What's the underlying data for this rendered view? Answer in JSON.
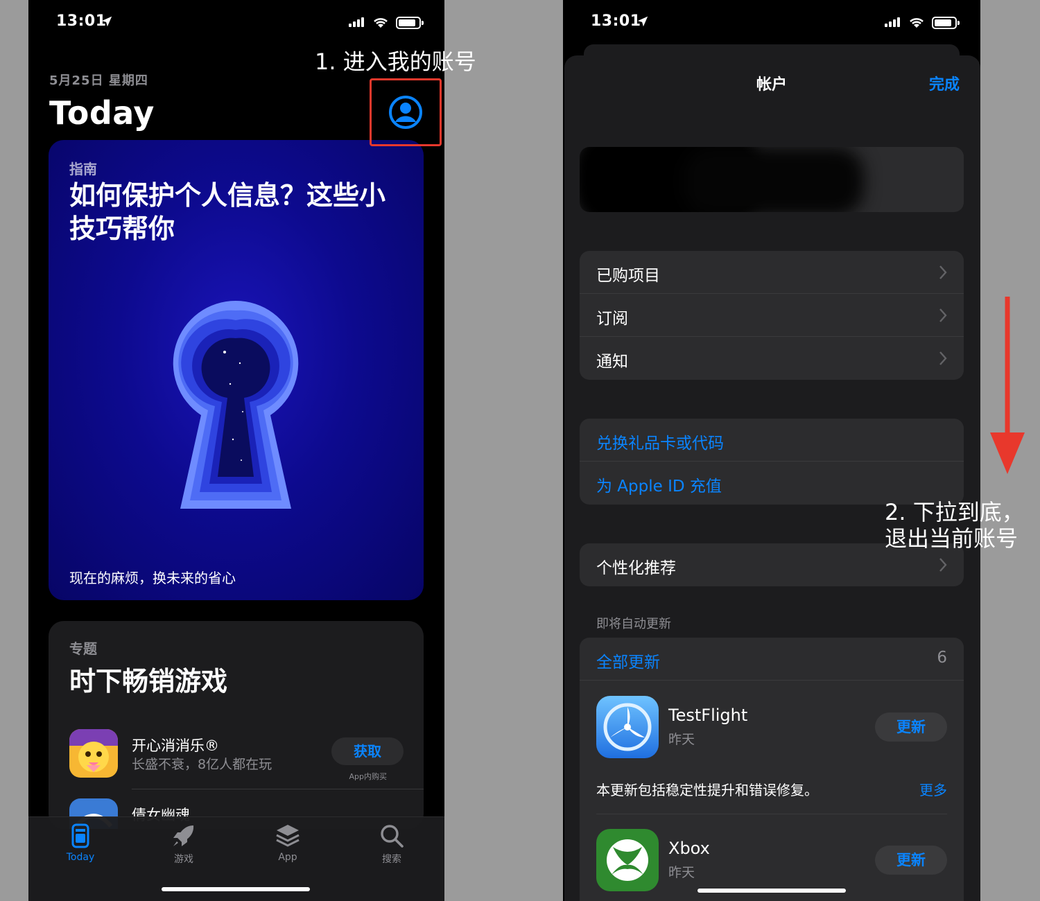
{
  "left_screen": {
    "status_bar": {
      "time": "13:01"
    },
    "date_label": "5月25日 星期四",
    "page_title": "Today",
    "card1": {
      "tag": "指南",
      "headline": "如何保护个人信息？这些小技巧帮你",
      "subtitle": "现在的麻烦，换未来的省心"
    },
    "card2": {
      "tag": "专题",
      "headline": "时下畅销游戏",
      "apps": [
        {
          "name": "开心消消乐®",
          "desc": "长盛不衰，8亿人都在玩",
          "button": "获取",
          "note": "App内购买"
        },
        {
          "name": "倩女幽魂",
          "desc": "",
          "button": "",
          "note": ""
        }
      ]
    },
    "tab_bar": [
      {
        "label": "Today",
        "icon": "today-icon",
        "active": true
      },
      {
        "label": "游戏",
        "icon": "rocket-icon",
        "active": false
      },
      {
        "label": "App",
        "icon": "layers-icon",
        "active": false
      },
      {
        "label": "搜索",
        "icon": "search-icon",
        "active": false
      }
    ]
  },
  "right_screen": {
    "status_bar": {
      "time": "13:01"
    },
    "nav": {
      "title": "帐户",
      "done": "完成"
    },
    "group1": [
      "已购项目",
      "订阅",
      "通知"
    ],
    "group2": [
      "兑换礼品卡或代码",
      "为 Apple ID 充值"
    ],
    "group3": [
      "个性化推荐"
    ],
    "updates_section": {
      "header": "即将自动更新",
      "update_all": "全部更新",
      "count": "6",
      "items": [
        {
          "name": "TestFlight",
          "date": "昨天",
          "button": "更新",
          "notes": "本更新包括稳定性提升和错误修复。",
          "more": "更多"
        },
        {
          "name": "Xbox",
          "date": "昨天",
          "button": "更新"
        }
      ]
    }
  },
  "annotations": {
    "step1": "1. 进入我的账号",
    "step2_line1": "2. 下拉到底，",
    "step2_line2": "退出当前账号"
  },
  "colors": {
    "accent": "#0a84ff",
    "annotation_red": "#e8382c",
    "card1_blue": "#0d0a8e"
  }
}
